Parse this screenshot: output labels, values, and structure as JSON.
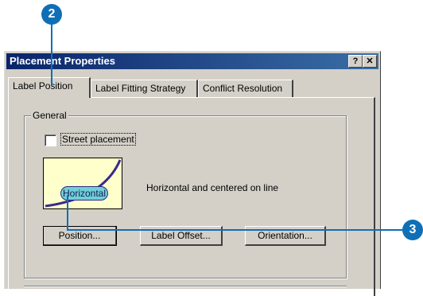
{
  "dialog": {
    "title": "Placement Properties",
    "help_btn": "?",
    "close_btn": "✕"
  },
  "tabs": [
    {
      "label": "Label Position"
    },
    {
      "label": "Label Fitting Strategy"
    },
    {
      "label": "Conflict Resolution"
    }
  ],
  "general": {
    "group_label": "General",
    "street_placement_label": "Street placement",
    "street_placement_checked": false,
    "preview_label": "Horizontal",
    "description": "Horizontal and centered on line"
  },
  "buttons": {
    "position": "Position...",
    "label_offset": "Label Offset...",
    "orientation": "Orientation..."
  },
  "callouts": {
    "step_2": "2",
    "step_3": "3"
  },
  "colors": {
    "titlebar": "#0a246a",
    "callout": "#0e6fb6",
    "dialog_bg": "#d4d0c8",
    "preview_bg": "#ffffcc",
    "preview_pill": "#6fd0d6",
    "curve": "#3a2a8a"
  }
}
